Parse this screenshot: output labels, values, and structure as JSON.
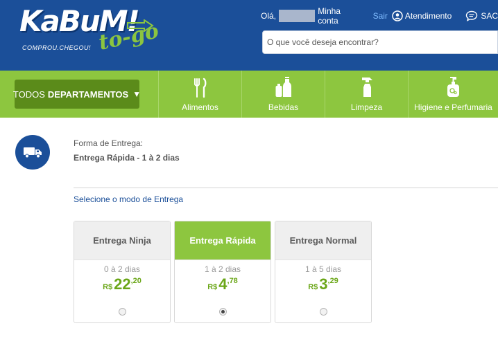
{
  "header": {
    "logo_text": "KaBuM!",
    "logo_sub": "to-go",
    "tagline": "COMPROU.CHEGOU!",
    "greeting": "Olá,",
    "my_account": "Minha conta",
    "logout": "Sair",
    "support": "Atendimento",
    "sac": "SAC",
    "search_placeholder": "O que você deseja encontrar?"
  },
  "nav": {
    "departments_prefix": "TODOS",
    "departments_bold": "DEPARTAMENTOS",
    "departments_arrow": "▼",
    "categories": [
      {
        "label": "Alimentos",
        "icon": "fork-knife-icon"
      },
      {
        "label": "Bebidas",
        "icon": "bottles-icon"
      },
      {
        "label": "Limpeza",
        "icon": "spray-bottle-icon"
      },
      {
        "label": "Higiene e Perfumaria",
        "icon": "soap-pump-icon"
      }
    ]
  },
  "delivery": {
    "icon": "truck-icon",
    "form_label": "Forma de Entrega:",
    "form_value": "Entrega Rápida - 1 à 2 dias",
    "select_label": "Selecione o modo de Entrega",
    "options": [
      {
        "name": "Entrega Ninja",
        "days": "0 à 2 dias",
        "currency": "R$",
        "price_int": "22",
        "price_cents": "20",
        "selected": false
      },
      {
        "name": "Entrega Rápida",
        "days": "1 à 2 dias",
        "currency": "R$",
        "price_int": "4",
        "price_cents": "78",
        "selected": true
      },
      {
        "name": "Entrega Normal",
        "days": "1 à 5 dias",
        "currency": "R$",
        "price_int": "3",
        "price_cents": "29",
        "selected": false
      }
    ]
  },
  "colors": {
    "brand_blue": "#1b4f99",
    "brand_green": "#8dc63f",
    "dark_green": "#5b8b1a",
    "price_green": "#6aa617"
  }
}
